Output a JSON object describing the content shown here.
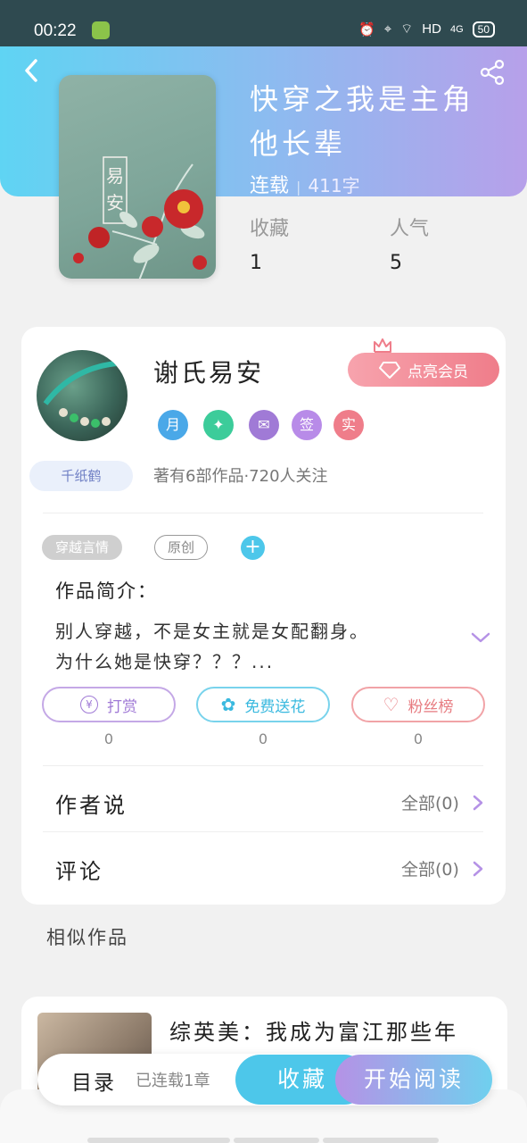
{
  "status_bar": {
    "time": "00:22",
    "network": "HD",
    "signal": "4G",
    "battery": "50"
  },
  "book": {
    "title": "快穿之我是主角他长辈",
    "status": "连载",
    "word_count": "411字",
    "stats": [
      {
        "label": "收藏",
        "value": "1"
      },
      {
        "label": "人气",
        "value": "5"
      }
    ],
    "cover_text": "易安"
  },
  "author": {
    "name": "谢氏易安",
    "vip_label": "点亮会员",
    "crane_badge": "千纸鹤",
    "badges": [
      {
        "text": "月",
        "color": "#4aa8e8"
      },
      {
        "text": "✦",
        "color": "#3ccc9a"
      },
      {
        "text": "✉",
        "color": "#a07ad6"
      },
      {
        "text": "签",
        "color": "#b88be8"
      },
      {
        "text": "实",
        "color": "#ef7d8a"
      }
    ],
    "summary": "著有6部作品·720人关注"
  },
  "tags": {
    "category": "穿越言情",
    "type": "原创",
    "add": "+"
  },
  "intro": {
    "title": "作品简介：",
    "text_line1": "别人穿越，不是女主就是女配翻身。",
    "text_line2": "为什么她是快穿？？？..."
  },
  "actions": [
    {
      "icon": "¥",
      "label": "打赏",
      "count": "0"
    },
    {
      "icon": "✿",
      "label": "免费送花",
      "count": "0"
    },
    {
      "icon": "♡",
      "label": "粉丝榜",
      "count": "0"
    }
  ],
  "rows": [
    {
      "label": "作者说",
      "all": "全部(0)"
    },
    {
      "label": "评论",
      "all": "全部(0)"
    }
  ],
  "similar": {
    "title": "相似作品",
    "item_name": "综英美：我成为富江那些年"
  },
  "bottom_bar": {
    "toc": "目录",
    "toc_status": "已连载1章",
    "favorite": "收藏",
    "start_reading": "开始阅读"
  },
  "colors": {
    "accent_blue": "#4dc7ea",
    "accent_purple": "#b592e6",
    "vip_pink": "#ef7d8a"
  }
}
